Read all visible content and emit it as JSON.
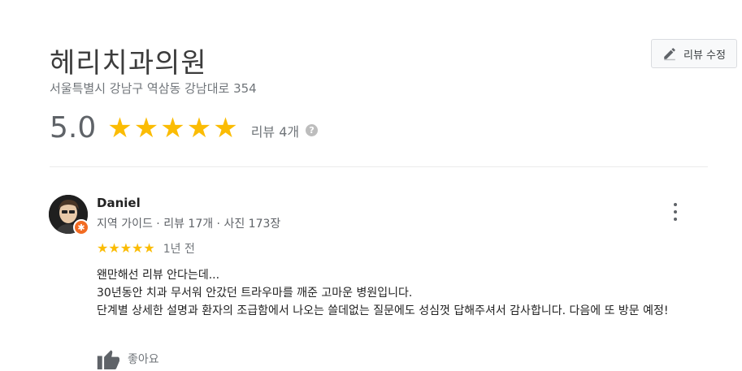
{
  "place": {
    "name": "헤리치과의원",
    "address": "서울특별시 강남구 역삼동 강남대로 354",
    "rating": "5.0",
    "stars": 5,
    "review_count_label": "리뷰 4개",
    "help_glyph": "?"
  },
  "actions": {
    "edit_review_label": "리뷰 수정"
  },
  "review": {
    "author": "Daniel",
    "author_meta": "지역 가이드 · 리뷰 17개 · 사진 173장",
    "stars": 5,
    "date": "1년 전",
    "text_lines": [
      "왠만해선 리뷰 안다는데...",
      "30년동안 치과 무서워 안갔던 트라우마를 깨준 고마운 병원입니다.",
      "단계별 상세한 설명과 환자의 조급함에서 나오는 쓸데없는 질문에도 성심껏 답해주셔서 감사합니다. 다음에 또 방문 예정!"
    ],
    "like_label": "좋아요"
  },
  "colors": {
    "star": "#fbbc04",
    "badge": "#f26b22",
    "muted_text": "#70757a"
  },
  "icons": [
    "pencil-icon",
    "star-icon",
    "help-icon",
    "local-guide-badge-icon",
    "more-vert-icon",
    "thumbs-up-icon"
  ]
}
